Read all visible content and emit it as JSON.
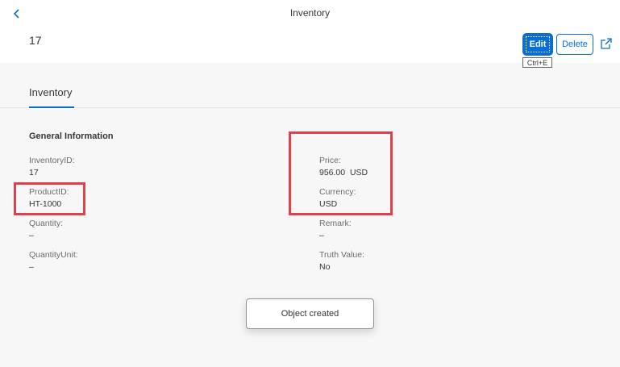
{
  "header": {
    "nav_title": "Inventory",
    "object_title": "17",
    "edit_label": "Edit",
    "delete_label": "Delete",
    "edit_tooltip": "Ctrl+E"
  },
  "tabs": [
    {
      "label": "Inventory",
      "selected": true
    }
  ],
  "section": {
    "title": "General Information",
    "left_fields": [
      {
        "label": "InventoryID:",
        "value": "17"
      },
      {
        "label": "ProductID:",
        "value": "HT-1000"
      },
      {
        "label": "Quantity:",
        "value": "–"
      },
      {
        "label": "QuantityUnit:",
        "value": "–"
      }
    ],
    "right_fields": [
      {
        "label": "Price:",
        "value": "956.00  USD"
      },
      {
        "label": "Currency:",
        "value": "USD"
      },
      {
        "label": "Remark:",
        "value": "–"
      },
      {
        "label": "Truth Value:",
        "value": "No"
      }
    ]
  },
  "toast": {
    "message": "Object created"
  },
  "icons": {
    "back": "chevron-left-icon",
    "share": "share-icon"
  },
  "colors": {
    "accent": "#0a6ed1",
    "highlight": "#e0414c",
    "background": "#f7f7f7"
  }
}
